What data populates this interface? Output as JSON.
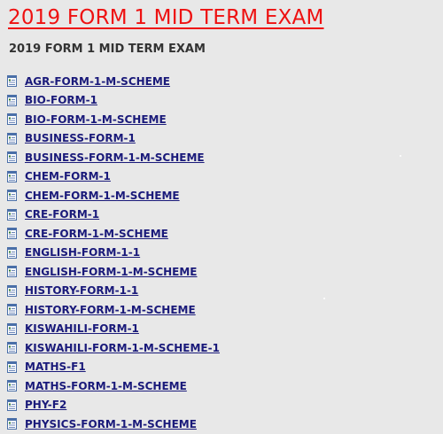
{
  "page": {
    "title": "2019 FORM 1 MID TERM EXAM",
    "subtitle": "2019 FORM 1 MID TERM EXAM"
  },
  "files": {
    "icon": "document-icon",
    "items": [
      {
        "label": "AGR-FORM-1-M-SCHEME"
      },
      {
        "label": "BIO-FORM-1"
      },
      {
        "label": "BIO-FORM-1-M-SCHEME"
      },
      {
        "label": "BUSINESS-FORM-1"
      },
      {
        "label": "BUSINESS-FORM-1-M-SCHEME"
      },
      {
        "label": "CHEM-FORM-1"
      },
      {
        "label": "CHEM-FORM-1-M-SCHEME"
      },
      {
        "label": "CRE-FORM-1"
      },
      {
        "label": "CRE-FORM-1-M-SCHEME"
      },
      {
        "label": "ENGLISH-FORM-1-1"
      },
      {
        "label": "ENGLISH-FORM-1-M-SCHEME"
      },
      {
        "label": "HISTORY-FORM-1-1"
      },
      {
        "label": "HISTORY-FORM-1-M-SCHEME"
      },
      {
        "label": "KISWAHILI-FORM-1"
      },
      {
        "label": "KISWAHILI-FORM-1-M-SCHEME-1"
      },
      {
        "label": "MATHS-F1"
      },
      {
        "label": "MATHS-FORM-1-M-SCHEME"
      },
      {
        "label": "PHY-F2"
      },
      {
        "label": "PHYSICS-FORM-1-M-SCHEME"
      }
    ]
  },
  "colors": {
    "title": "#ee1111",
    "link": "#1a1a7a",
    "background": "#e8e8e8"
  }
}
